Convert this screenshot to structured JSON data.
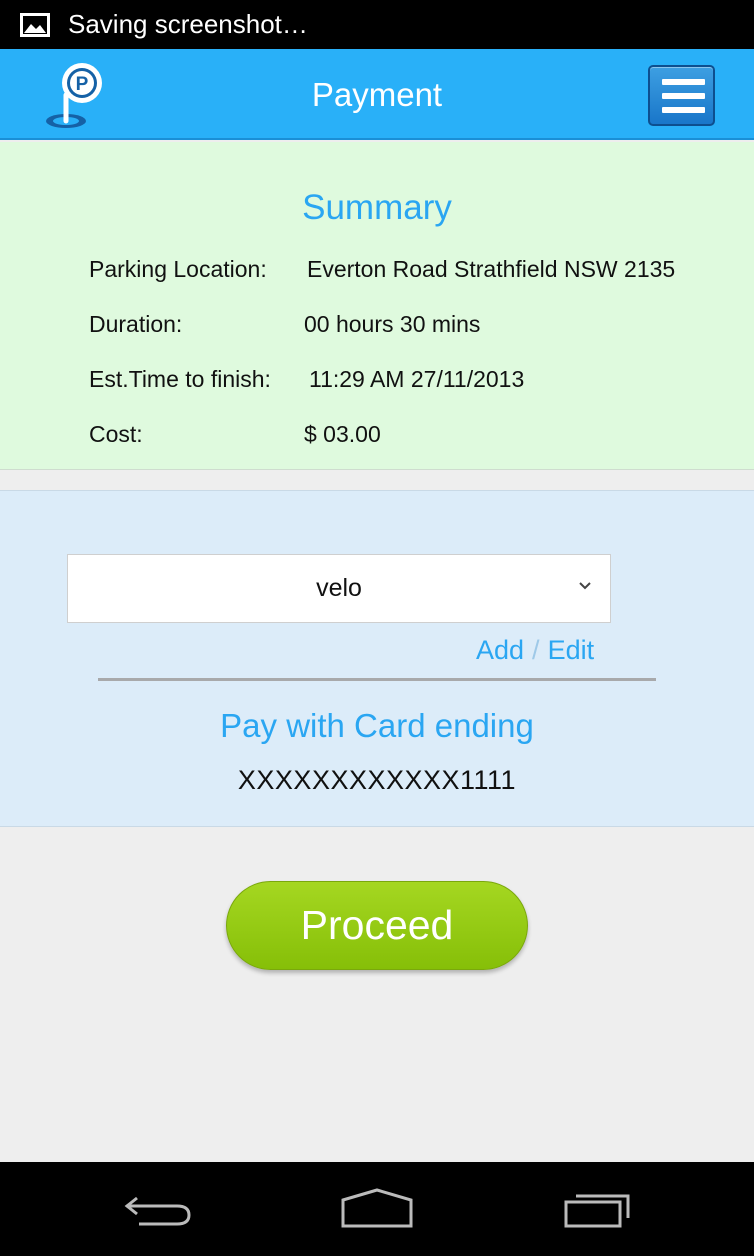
{
  "status_bar": {
    "text": "Saving screenshot…",
    "icon": "image-icon"
  },
  "header": {
    "title": "Payment",
    "logo_icon": "parking-pin-logo",
    "menu_icon": "hamburger-menu-icon",
    "color": "#29b0f8"
  },
  "summary": {
    "title": "Summary",
    "rows": [
      {
        "label": "Parking Location:",
        "value": "Everton Road Strathfield NSW 2135"
      },
      {
        "label": "Duration:",
        "value": "00 hours 30 mins"
      },
      {
        "label": "Est.Time to finish:",
        "value": "11:29 AM 27/11/2013"
      },
      {
        "label": "Cost:",
        "value": "$ 03.00"
      }
    ],
    "background": "#dffade"
  },
  "payment": {
    "selected_card": "velo",
    "add_label": "Add",
    "separator": "/",
    "edit_label": "Edit",
    "pay_title": "Pay with Card ending",
    "card_number": "XXXXXXXXXXXX1111",
    "accent": "#2aa6f2"
  },
  "proceed": {
    "label": "Proceed",
    "color": "#93c90f"
  },
  "nav_bar": {
    "back_icon": "back-icon",
    "home_icon": "home-icon",
    "recents_icon": "recent-apps-icon"
  }
}
